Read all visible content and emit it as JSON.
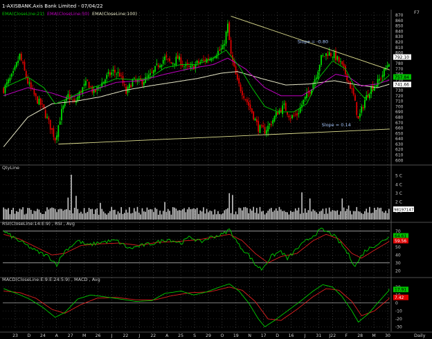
{
  "header": {
    "title": "1-AXISBANK.Axis Bank Limited - 07/04/22",
    "legend": [
      {
        "text": "EMA(CloseLine:21)",
        "color": "#00c000"
      },
      {
        "text": "EMA(CloseLine:50)",
        "color": "#c000c0"
      },
      {
        "text": "EMA(CloseLine:100)",
        "color": "#e8e8c8"
      }
    ],
    "corner": "F7"
  },
  "colors": {
    "up": "#00e000",
    "down": "#e00000",
    "trendline": "#e0e090",
    "grid": "#ffffff",
    "volume": "#c8c8c8",
    "rsi": "#00d000",
    "signal": "#e02020",
    "axis_text": "#cfcfcf"
  },
  "chart_data": [
    {
      "type": "candlestick",
      "panel": "price",
      "y_ticks": [
        "870",
        "860",
        "850",
        "840",
        "830",
        "820",
        "810",
        "800",
        "790",
        "780",
        "770",
        "760",
        "750",
        "740",
        "730",
        "720",
        "710",
        "700",
        "690",
        "680",
        "670",
        "660",
        "650",
        "640",
        "630",
        "620",
        "610",
        "600"
      ],
      "ylim": [
        595,
        875
      ],
      "close_path": [
        [
          0,
          732
        ],
        [
          6,
          760
        ],
        [
          10,
          795
        ],
        [
          15,
          745
        ],
        [
          20,
          715
        ],
        [
          24,
          700
        ],
        [
          28,
          670
        ],
        [
          32,
          640
        ],
        [
          36,
          690
        ],
        [
          40,
          720
        ],
        [
          44,
          705
        ],
        [
          48,
          730
        ],
        [
          52,
          745
        ],
        [
          56,
          725
        ],
        [
          60,
          740
        ],
        [
          64,
          755
        ],
        [
          68,
          765
        ],
        [
          72,
          760
        ],
        [
          76,
          725
        ],
        [
          80,
          748
        ],
        [
          84,
          745
        ],
        [
          88,
          750
        ],
        [
          92,
          760
        ],
        [
          96,
          778
        ],
        [
          100,
          790
        ],
        [
          104,
          780
        ],
        [
          108,
          790
        ],
        [
          112,
          775
        ],
        [
          116,
          770
        ],
        [
          120,
          780
        ],
        [
          124,
          785
        ],
        [
          128,
          790
        ],
        [
          132,
          800
        ],
        [
          136,
          808
        ],
        [
          139,
          850
        ],
        [
          141,
          795
        ],
        [
          145,
          745
        ],
        [
          150,
          715
        ],
        [
          154,
          690
        ],
        [
          158,
          660
        ],
        [
          162,
          655
        ],
        [
          166,
          670
        ],
        [
          170,
          690
        ],
        [
          174,
          700
        ],
        [
          178,
          680
        ],
        [
          182,
          685
        ],
        [
          186,
          710
        ],
        [
          190,
          730
        ],
        [
          194,
          760
        ],
        [
          197,
          790
        ],
        [
          201,
          800
        ],
        [
          205,
          795
        ],
        [
          209,
          780
        ],
        [
          213,
          755
        ],
        [
          217,
          720
        ],
        [
          220,
          675
        ],
        [
          224,
          712
        ],
        [
          228,
          735
        ],
        [
          232,
          745
        ],
        [
          236,
          765
        ],
        [
          240,
          790
        ]
      ],
      "ema21_path": [
        [
          0,
          735
        ],
        [
          15,
          755
        ],
        [
          25,
          735
        ],
        [
          32,
          705
        ],
        [
          40,
          715
        ],
        [
          50,
          730
        ],
        [
          60,
          740
        ],
        [
          70,
          752
        ],
        [
          80,
          750
        ],
        [
          90,
          752
        ],
        [
          100,
          772
        ],
        [
          110,
          778
        ],
        [
          120,
          778
        ],
        [
          130,
          790
        ],
        [
          138,
          805
        ],
        [
          146,
          775
        ],
        [
          154,
          735
        ],
        [
          162,
          700
        ],
        [
          170,
          690
        ],
        [
          180,
          690
        ],
        [
          188,
          705
        ],
        [
          196,
          755
        ],
        [
          204,
          785
        ],
        [
          212,
          770
        ],
        [
          218,
          735
        ],
        [
          224,
          715
        ],
        [
          232,
          740
        ],
        [
          240,
          760
        ]
      ],
      "ema50_path": [
        [
          0,
          720
        ],
        [
          15,
          735
        ],
        [
          30,
          725
        ],
        [
          40,
          715
        ],
        [
          55,
          730
        ],
        [
          70,
          745
        ],
        [
          85,
          748
        ],
        [
          100,
          760
        ],
        [
          115,
          770
        ],
        [
          130,
          778
        ],
        [
          139,
          790
        ],
        [
          150,
          770
        ],
        [
          162,
          735
        ],
        [
          172,
          720
        ],
        [
          185,
          720
        ],
        [
          196,
          740
        ],
        [
          206,
          760
        ],
        [
          214,
          755
        ],
        [
          222,
          738
        ],
        [
          232,
          742
        ],
        [
          240,
          750
        ]
      ],
      "ema100_path": [
        [
          0,
          625
        ],
        [
          15,
          680
        ],
        [
          30,
          705
        ],
        [
          45,
          710
        ],
        [
          60,
          718
        ],
        [
          75,
          730
        ],
        [
          90,
          738
        ],
        [
          105,
          745
        ],
        [
          120,
          752
        ],
        [
          135,
          762
        ],
        [
          145,
          765
        ],
        [
          160,
          752
        ],
        [
          175,
          740
        ],
        [
          190,
          742
        ],
        [
          205,
          748
        ],
        [
          220,
          740
        ],
        [
          232,
          735
        ],
        [
          240,
          742
        ]
      ],
      "trendlines": [
        {
          "from": [
            141,
            868
          ],
          "to": [
            240,
            768
          ]
        },
        {
          "from": [
            34,
            630
          ],
          "to": [
            240,
            658
          ]
        }
      ],
      "annotations": [
        {
          "text": "Slope = -0.80",
          "x": 190,
          "y": 818
        },
        {
          "text": "Slope = 0.14",
          "x": 205,
          "y": 663
        }
      ],
      "price_tags": [
        {
          "text": "792.10",
          "bg": "#ffffff",
          "fg": "#000000",
          "value": 792
        },
        {
          "text": "757.84",
          "bg": "#00c000",
          "fg": "#000000",
          "value": 755
        },
        {
          "text": "741.66",
          "bg": "#ffffff",
          "fg": "#000000",
          "value": 741
        }
      ]
    },
    {
      "type": "bar",
      "panel": "volume",
      "title": "QtyLine",
      "y_ticks": [
        "5 C",
        "4 C",
        "3 C",
        "2 C",
        "1 C"
      ],
      "ylim": [
        0,
        5.5
      ],
      "value_tag": "98197147",
      "spikes": [
        [
          42,
          5.1
        ],
        [
          40,
          2.5
        ],
        [
          45,
          2.7
        ],
        [
          60,
          1.9
        ],
        [
          100,
          2.0
        ],
        [
          140,
          3.0
        ],
        [
          142,
          2.8
        ],
        [
          185,
          3.1
        ],
        [
          190,
          2.4
        ],
        [
          210,
          2.4
        ],
        [
          214,
          1.6
        ]
      ]
    },
    {
      "type": "line",
      "panel": "rsi",
      "title": "RSI(CloseLine:14:E:9) , RSI , Avg",
      "y_ticks": [
        "70",
        "60",
        "50",
        "40",
        "30",
        "20"
      ],
      "ylim": [
        15,
        75
      ],
      "value_tags": [
        {
          "text": "64.61",
          "bg": "#00c000",
          "fg": "#000000",
          "value": 64
        },
        {
          "text": "59.56",
          "bg": "#e00000",
          "fg": "#ffffff",
          "value": 58
        }
      ],
      "rsi_path": [
        [
          0,
          70
        ],
        [
          6,
          62
        ],
        [
          12,
          55
        ],
        [
          20,
          45
        ],
        [
          28,
          38
        ],
        [
          33,
          28
        ],
        [
          38,
          45
        ],
        [
          46,
          58
        ],
        [
          52,
          52
        ],
        [
          60,
          56
        ],
        [
          70,
          58
        ],
        [
          78,
          48
        ],
        [
          86,
          52
        ],
        [
          94,
          55
        ],
        [
          102,
          60
        ],
        [
          110,
          55
        ],
        [
          116,
          63
        ],
        [
          122,
          56
        ],
        [
          128,
          62
        ],
        [
          136,
          66
        ],
        [
          140,
          72
        ],
        [
          146,
          52
        ],
        [
          152,
          40
        ],
        [
          156,
          28
        ],
        [
          160,
          22
        ],
        [
          166,
          38
        ],
        [
          172,
          45
        ],
        [
          176,
          35
        ],
        [
          182,
          48
        ],
        [
          188,
          58
        ],
        [
          193,
          66
        ],
        [
          197,
          72
        ],
        [
          204,
          66
        ],
        [
          210,
          52
        ],
        [
          214,
          40
        ],
        [
          218,
          26
        ],
        [
          224,
          45
        ],
        [
          230,
          52
        ],
        [
          236,
          58
        ],
        [
          240,
          66
        ]
      ],
      "avg_path": [
        [
          0,
          66
        ],
        [
          10,
          60
        ],
        [
          20,
          50
        ],
        [
          30,
          40
        ],
        [
          38,
          42
        ],
        [
          48,
          52
        ],
        [
          60,
          54
        ],
        [
          72,
          55
        ],
        [
          84,
          52
        ],
        [
          96,
          56
        ],
        [
          108,
          57
        ],
        [
          120,
          59
        ],
        [
          132,
          63
        ],
        [
          140,
          66
        ],
        [
          148,
          58
        ],
        [
          156,
          42
        ],
        [
          164,
          30
        ],
        [
          172,
          38
        ],
        [
          182,
          42
        ],
        [
          192,
          58
        ],
        [
          200,
          66
        ],
        [
          208,
          60
        ],
        [
          216,
          42
        ],
        [
          222,
          36
        ],
        [
          230,
          46
        ],
        [
          240,
          58
        ]
      ]
    },
    {
      "type": "line",
      "panel": "macd",
      "title": "MACD(CloseLine:E:9:E:24:5:9) , MACD , Avg",
      "y_ticks": [
        "20",
        "10",
        "0",
        "-10",
        "-20",
        "-30"
      ],
      "ylim": [
        -34,
        25
      ],
      "value_tags": [
        {
          "text": "17.91",
          "bg": "#00c000",
          "fg": "#000000",
          "value": 17
        },
        {
          "text": "7.42",
          "bg": "#e00000",
          "fg": "#ffffff",
          "value": 7
        }
      ],
      "macd_path": [
        [
          0,
          18
        ],
        [
          8,
          12
        ],
        [
          16,
          5
        ],
        [
          24,
          -5
        ],
        [
          32,
          -18
        ],
        [
          38,
          -12
        ],
        [
          46,
          5
        ],
        [
          54,
          10
        ],
        [
          62,
          8
        ],
        [
          72,
          5
        ],
        [
          82,
          2
        ],
        [
          92,
          3
        ],
        [
          100,
          12
        ],
        [
          110,
          15
        ],
        [
          118,
          10
        ],
        [
          126,
          14
        ],
        [
          134,
          20
        ],
        [
          140,
          24
        ],
        [
          146,
          15
        ],
        [
          152,
          0
        ],
        [
          158,
          -20
        ],
        [
          162,
          -30
        ],
        [
          168,
          -22
        ],
        [
          176,
          -10
        ],
        [
          184,
          2
        ],
        [
          192,
          15
        ],
        [
          198,
          23
        ],
        [
          204,
          20
        ],
        [
          210,
          8
        ],
        [
          216,
          -10
        ],
        [
          220,
          -24
        ],
        [
          226,
          -14
        ],
        [
          232,
          0
        ],
        [
          240,
          18
        ]
      ],
      "signal_path": [
        [
          0,
          15
        ],
        [
          10,
          13
        ],
        [
          20,
          6
        ],
        [
          30,
          -8
        ],
        [
          38,
          -13
        ],
        [
          48,
          -2
        ],
        [
          58,
          6
        ],
        [
          70,
          7
        ],
        [
          82,
          4
        ],
        [
          94,
          4
        ],
        [
          104,
          9
        ],
        [
          116,
          13
        ],
        [
          128,
          14
        ],
        [
          140,
          20
        ],
        [
          148,
          16
        ],
        [
          156,
          2
        ],
        [
          164,
          -20
        ],
        [
          172,
          -22
        ],
        [
          182,
          -8
        ],
        [
          192,
          8
        ],
        [
          200,
          18
        ],
        [
          208,
          16
        ],
        [
          216,
          2
        ],
        [
          222,
          -16
        ],
        [
          230,
          -10
        ],
        [
          240,
          7
        ]
      ]
    }
  ],
  "x_axis": {
    "labels": [
      "23",
      "D",
      "24",
      "A",
      "27",
      "M",
      "26",
      "J",
      "22",
      "J",
      "22",
      "A",
      "25",
      "S",
      "29",
      "O",
      "19",
      "N",
      "17",
      "D",
      "16",
      "J",
      "31",
      "J22",
      "F",
      "28",
      "M",
      "30"
    ],
    "period": "Daily"
  }
}
